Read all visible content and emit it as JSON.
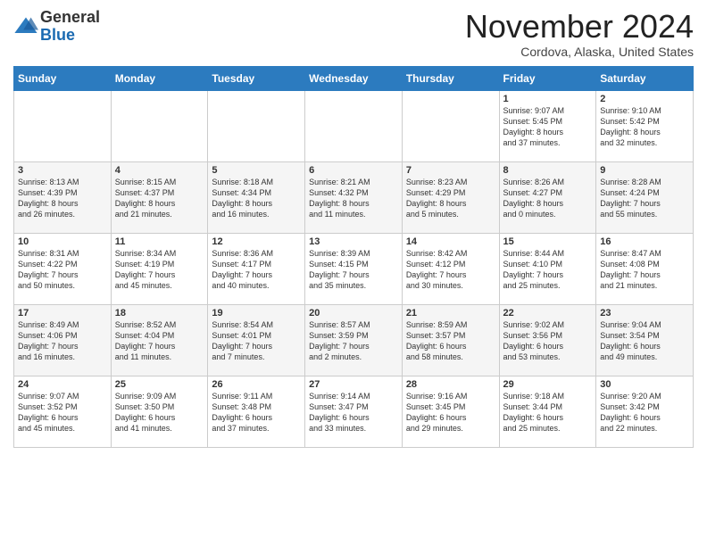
{
  "header": {
    "logo_line1": "General",
    "logo_line2": "Blue",
    "month": "November 2024",
    "location": "Cordova, Alaska, United States"
  },
  "weekdays": [
    "Sunday",
    "Monday",
    "Tuesday",
    "Wednesday",
    "Thursday",
    "Friday",
    "Saturday"
  ],
  "weeks": [
    [
      {
        "day": "",
        "info": ""
      },
      {
        "day": "",
        "info": ""
      },
      {
        "day": "",
        "info": ""
      },
      {
        "day": "",
        "info": ""
      },
      {
        "day": "",
        "info": ""
      },
      {
        "day": "1",
        "info": "Sunrise: 9:07 AM\nSunset: 5:45 PM\nDaylight: 8 hours\nand 37 minutes."
      },
      {
        "day": "2",
        "info": "Sunrise: 9:10 AM\nSunset: 5:42 PM\nDaylight: 8 hours\nand 32 minutes."
      }
    ],
    [
      {
        "day": "3",
        "info": "Sunrise: 8:13 AM\nSunset: 4:39 PM\nDaylight: 8 hours\nand 26 minutes."
      },
      {
        "day": "4",
        "info": "Sunrise: 8:15 AM\nSunset: 4:37 PM\nDaylight: 8 hours\nand 21 minutes."
      },
      {
        "day": "5",
        "info": "Sunrise: 8:18 AM\nSunset: 4:34 PM\nDaylight: 8 hours\nand 16 minutes."
      },
      {
        "day": "6",
        "info": "Sunrise: 8:21 AM\nSunset: 4:32 PM\nDaylight: 8 hours\nand 11 minutes."
      },
      {
        "day": "7",
        "info": "Sunrise: 8:23 AM\nSunset: 4:29 PM\nDaylight: 8 hours\nand 5 minutes."
      },
      {
        "day": "8",
        "info": "Sunrise: 8:26 AM\nSunset: 4:27 PM\nDaylight: 8 hours\nand 0 minutes."
      },
      {
        "day": "9",
        "info": "Sunrise: 8:28 AM\nSunset: 4:24 PM\nDaylight: 7 hours\nand 55 minutes."
      }
    ],
    [
      {
        "day": "10",
        "info": "Sunrise: 8:31 AM\nSunset: 4:22 PM\nDaylight: 7 hours\nand 50 minutes."
      },
      {
        "day": "11",
        "info": "Sunrise: 8:34 AM\nSunset: 4:19 PM\nDaylight: 7 hours\nand 45 minutes."
      },
      {
        "day": "12",
        "info": "Sunrise: 8:36 AM\nSunset: 4:17 PM\nDaylight: 7 hours\nand 40 minutes."
      },
      {
        "day": "13",
        "info": "Sunrise: 8:39 AM\nSunset: 4:15 PM\nDaylight: 7 hours\nand 35 minutes."
      },
      {
        "day": "14",
        "info": "Sunrise: 8:42 AM\nSunset: 4:12 PM\nDaylight: 7 hours\nand 30 minutes."
      },
      {
        "day": "15",
        "info": "Sunrise: 8:44 AM\nSunset: 4:10 PM\nDaylight: 7 hours\nand 25 minutes."
      },
      {
        "day": "16",
        "info": "Sunrise: 8:47 AM\nSunset: 4:08 PM\nDaylight: 7 hours\nand 21 minutes."
      }
    ],
    [
      {
        "day": "17",
        "info": "Sunrise: 8:49 AM\nSunset: 4:06 PM\nDaylight: 7 hours\nand 16 minutes."
      },
      {
        "day": "18",
        "info": "Sunrise: 8:52 AM\nSunset: 4:04 PM\nDaylight: 7 hours\nand 11 minutes."
      },
      {
        "day": "19",
        "info": "Sunrise: 8:54 AM\nSunset: 4:01 PM\nDaylight: 7 hours\nand 7 minutes."
      },
      {
        "day": "20",
        "info": "Sunrise: 8:57 AM\nSunset: 3:59 PM\nDaylight: 7 hours\nand 2 minutes."
      },
      {
        "day": "21",
        "info": "Sunrise: 8:59 AM\nSunset: 3:57 PM\nDaylight: 6 hours\nand 58 minutes."
      },
      {
        "day": "22",
        "info": "Sunrise: 9:02 AM\nSunset: 3:56 PM\nDaylight: 6 hours\nand 53 minutes."
      },
      {
        "day": "23",
        "info": "Sunrise: 9:04 AM\nSunset: 3:54 PM\nDaylight: 6 hours\nand 49 minutes."
      }
    ],
    [
      {
        "day": "24",
        "info": "Sunrise: 9:07 AM\nSunset: 3:52 PM\nDaylight: 6 hours\nand 45 minutes."
      },
      {
        "day": "25",
        "info": "Sunrise: 9:09 AM\nSunset: 3:50 PM\nDaylight: 6 hours\nand 41 minutes."
      },
      {
        "day": "26",
        "info": "Sunrise: 9:11 AM\nSunset: 3:48 PM\nDaylight: 6 hours\nand 37 minutes."
      },
      {
        "day": "27",
        "info": "Sunrise: 9:14 AM\nSunset: 3:47 PM\nDaylight: 6 hours\nand 33 minutes."
      },
      {
        "day": "28",
        "info": "Sunrise: 9:16 AM\nSunset: 3:45 PM\nDaylight: 6 hours\nand 29 minutes."
      },
      {
        "day": "29",
        "info": "Sunrise: 9:18 AM\nSunset: 3:44 PM\nDaylight: 6 hours\nand 25 minutes."
      },
      {
        "day": "30",
        "info": "Sunrise: 9:20 AM\nSunset: 3:42 PM\nDaylight: 6 hours\nand 22 minutes."
      }
    ]
  ]
}
